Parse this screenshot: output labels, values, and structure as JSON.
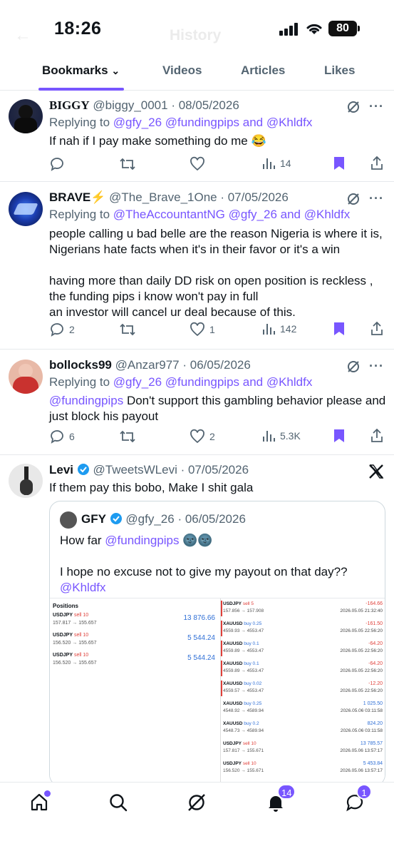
{
  "status": {
    "time": "18:26",
    "battery": "80",
    "ghost_title": "History"
  },
  "tabs": [
    {
      "label": "Bookmarks",
      "active": true
    },
    {
      "label": "Videos",
      "active": false
    },
    {
      "label": "Articles",
      "active": false
    },
    {
      "label": "Likes",
      "active": false
    }
  ],
  "posts": [
    {
      "name": "BIGGY",
      "handle": "@biggy_0001 · 08/05/2026",
      "reply_prefix": "Replying to ",
      "reply_mentions": "@gfy_26 @fundingpips and @Khldfx",
      "text": "If nah if I pay make something do me 😂",
      "replies": "",
      "likes": "",
      "views": "14"
    },
    {
      "name": "BRAVE⚡",
      "handle": "@The_Brave_1One · 07/05/2026",
      "reply_prefix": "Replying to ",
      "reply_mentions": "@TheAccountantNG @gfy_26 and @Khldfx",
      "text": "people calling u bad belle are the reason Nigeria is where it is, Nigerians hate  facts when it's in their favor or it's a win\n\nhaving more than daily DD risk on open position is reckless , the funding pips i know won't pay in full\nan investor will cancel ur deal because of this.",
      "replies": "2",
      "likes": "1",
      "views": "142"
    },
    {
      "name": "bollocks99",
      "handle": "@Anzar977 · 06/05/2026",
      "reply_prefix": "Replying to ",
      "reply_mentions": "@gfy_26 @fundingpips and @Khldfx",
      "text_mention": "@fundingpips",
      "text": " Don't support this gambling behavior please and just block his payout",
      "replies": "6",
      "likes": "2",
      "views": "5.3K"
    },
    {
      "name": "Levi",
      "handle": "@TweetsWLevi · 07/05/2026",
      "text": "If them pay this bobo, Make I shit gala"
    }
  ],
  "quote": {
    "name": "GFY",
    "handle": "@gfy_26 · 06/05/2026",
    "line1": "How far ",
    "line1_mention": "@fundingpips",
    "line1_emoji": " 🌚🌚",
    "line2": "I hope no excuse not to give my payout on that day??",
    "line3_mention": "@Khldfx"
  },
  "positions": {
    "title": "Positions",
    "rows": [
      {
        "sym": "USDJPY",
        "side": "sell 10",
        "price": "157.817 → 155.657",
        "pnl": "13 876.66"
      },
      {
        "sym": "USDJPY",
        "side": "sell 10",
        "price": "156.520 → 155.657",
        "pnl": "5 544.24"
      },
      {
        "sym": "USDJPY",
        "side": "sell 10",
        "price": "156.520 → 155.657",
        "pnl": "5 544.24"
      }
    ]
  },
  "trades": [
    {
      "sym": "USDJPY",
      "side": "sell 5",
      "price": "157.856 → 157.908",
      "pnl": "-164.66",
      "date": "2026.05.05 21:32:40"
    },
    {
      "sym": "XAUUSD",
      "side": "buy 0.25",
      "price": "4559.93 → 4553.47",
      "pnl": "-161.50",
      "date": "2026.05.05 22:56:20"
    },
    {
      "sym": "XAUUSD",
      "side": "buy 0.1",
      "price": "4559.89 → 4553.47",
      "pnl": "-64.20",
      "date": "2026.05.05 22:56:20"
    },
    {
      "sym": "XAUUSD",
      "side": "buy 0.1",
      "price": "4559.89 → 4553.47",
      "pnl": "-64.20",
      "date": "2026.05.05 22:56:20"
    },
    {
      "sym": "XAUUSD",
      "side": "buy 0.02",
      "price": "4559.57 → 4553.47",
      "pnl": "-12.20",
      "date": "2026.05.05 22:56:20"
    },
    {
      "sym": "XAUUSD",
      "side": "buy 0.25",
      "price": "4548.92 → 4589.94",
      "pnl": "1 025.50",
      "date": "2026.05.06 03:11:58"
    },
    {
      "sym": "XAUUSD",
      "side": "buy 0.2",
      "price": "4548.73 → 4589.94",
      "pnl": "824.20",
      "date": "2026.05.06 03:11:58"
    },
    {
      "sym": "USDJPY",
      "side": "sell 10",
      "price": "157.817 → 155.671",
      "pnl": "13 785.57",
      "date": "2026.05.06 13:57:17"
    },
    {
      "sym": "USDJPY",
      "side": "sell 10",
      "price": "156.520 → 155.671",
      "pnl": "5 453.84",
      "date": "2026.05.06 13:57:17"
    }
  ],
  "nav": {
    "notifications_badge": "14",
    "messages_badge": "1"
  },
  "colors": {
    "accent": "#7856ff",
    "text": "#0f1419",
    "muted": "#536471",
    "loss": "#e0403a",
    "gain": "#2f6fd6"
  }
}
